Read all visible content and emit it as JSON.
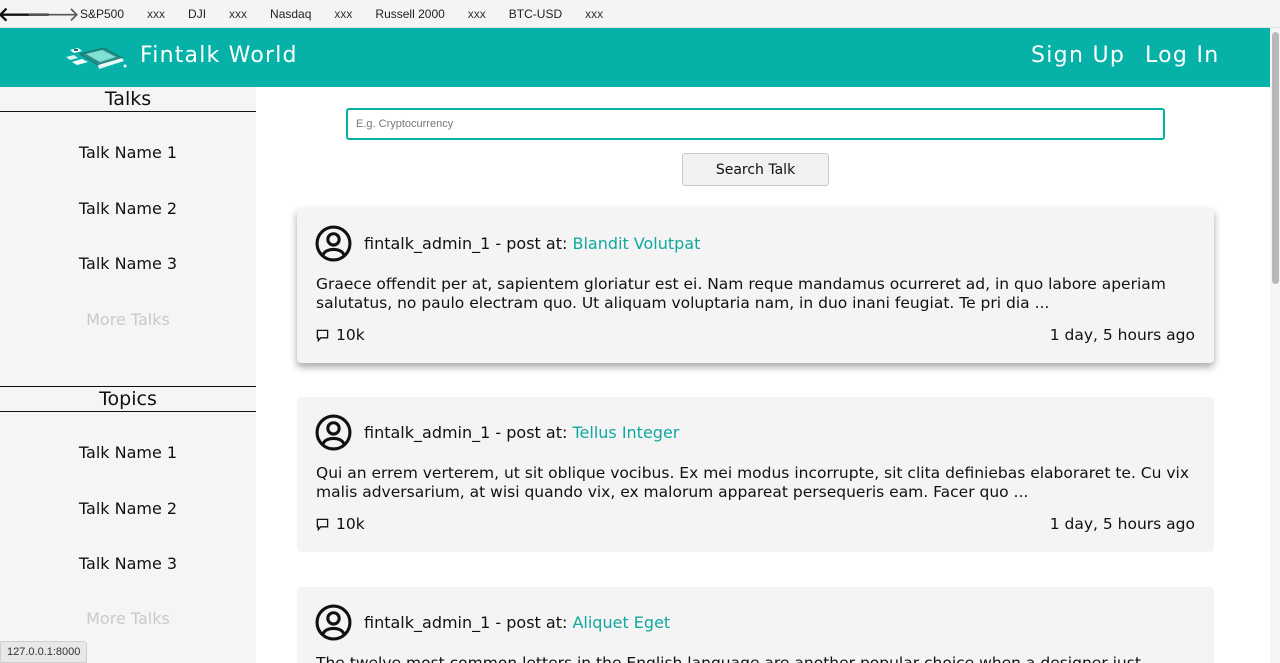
{
  "browser": {
    "back_icon": "arrow-left-icon",
    "forward_icon": "arrow-right-icon",
    "back_glyph": "🡐",
    "forward_glyph": "🡒",
    "status_url": "127.0.0.1:8000"
  },
  "ticker": [
    {
      "symbol": "S&P500",
      "value": "xxx"
    },
    {
      "symbol": "DJI",
      "value": "xxx"
    },
    {
      "symbol": "Nasdaq",
      "value": "xxx"
    },
    {
      "symbol": "Russell 2000",
      "value": "xxx"
    },
    {
      "symbol": "BTC-USD",
      "value": "xxx"
    }
  ],
  "header": {
    "brand": "Fintalk World",
    "signup": "Sign Up",
    "login": "Log In",
    "accent_color": "#06b2a8"
  },
  "sidebar": {
    "talks_title": "Talks",
    "talks": [
      "Talk Name 1",
      "Talk Name 2",
      "Talk Name 3"
    ],
    "talks_more": "More Talks",
    "topics_title": "Topics",
    "topics": [
      "Talk Name 1",
      "Talk Name 2",
      "Talk Name 3"
    ],
    "topics_more": "More Talks"
  },
  "search": {
    "placeholder": "E.g. Cryptocurrency",
    "button": "Search Talk"
  },
  "posts": [
    {
      "author": "fintalk_admin_1",
      "sep": " - post at: ",
      "talk": "Blandit Volutpat",
      "body": "Graece offendit per at, sapientem gloriatur est ei. Nam reque mandamus ocurreret ad, in quo labore aperiam salutatus, no paulo electram quo. Ut aliquam voluptaria nam, in duo inani feugiat. Te pri dia ...",
      "comments": "10k",
      "time": "1 day, 5 hours ago"
    },
    {
      "author": "fintalk_admin_1",
      "sep": " - post at: ",
      "talk": "Tellus Integer",
      "body": "Qui an errem verterem, ut sit oblique vocibus. Ex mei modus incorrupte, sit clita definiebas elaboraret te. Cu vix malis adversarium, at wisi quando vix, ex malorum appareat persequeris eam. Facer quo ...",
      "comments": "10k",
      "time": "1 day, 5 hours ago"
    },
    {
      "author": "fintalk_admin_1",
      "sep": " - post at: ",
      "talk": "Aliquet Eget",
      "body": "The twelve most common letters in the English language are another popular choice when a designer just",
      "comments": "",
      "time": ""
    }
  ]
}
